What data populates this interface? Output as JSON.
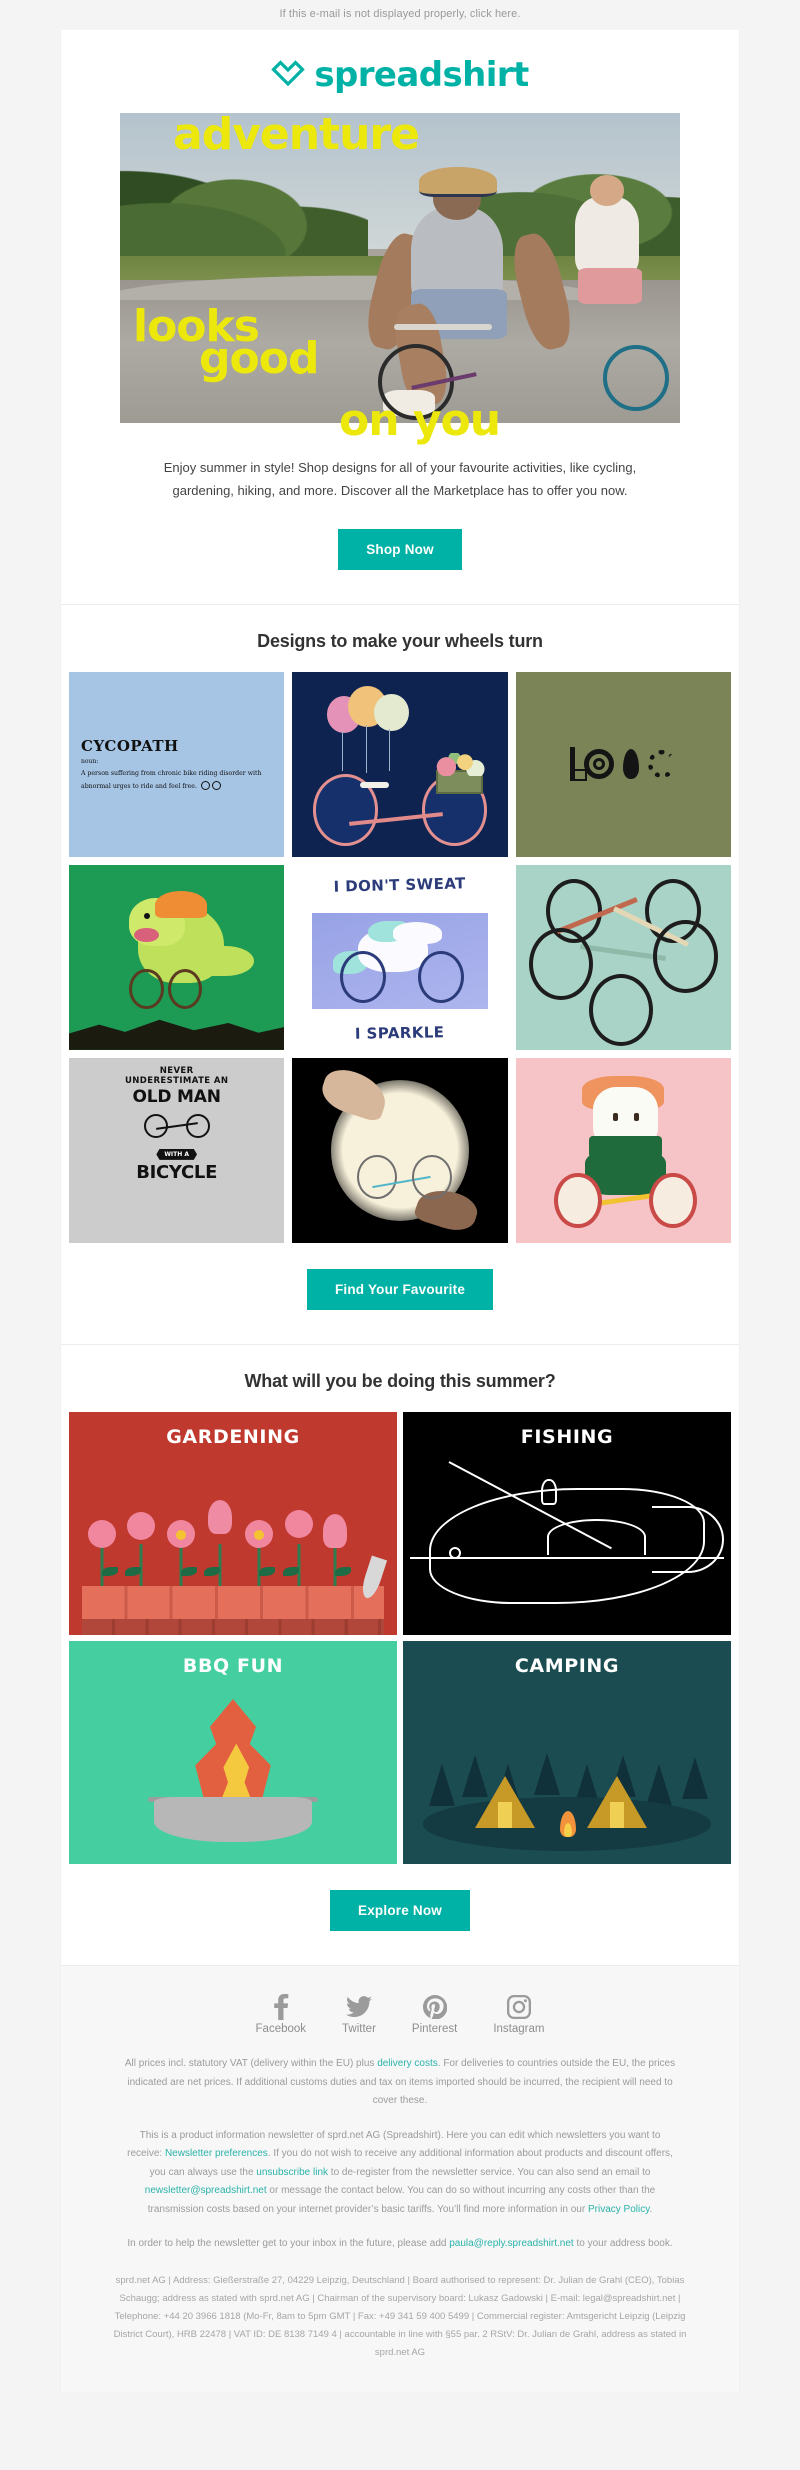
{
  "preheader": "If this e-mail is not displayed properly, click here.",
  "brand": {
    "name": "spreadshirt",
    "accent": "#00b2a5",
    "highlight": "#ece80c"
  },
  "hero": {
    "words": {
      "w1": "adventure",
      "w2": "looks",
      "w3": "good",
      "w4": "on you"
    },
    "body": "Enjoy summer in style! Shop designs for all of your favourite activities, like cycling, gardening, hiking, and more. Discover all the Marketplace has to offer you now.",
    "cta": "Shop Now"
  },
  "designs": {
    "title": "Designs to make your wheels turn",
    "cta": "Find Your Favourite",
    "tiles": [
      {
        "name": "cycopath",
        "bg": "#a6c4e4",
        "heading": "CYCOPATH",
        "pos": "noun:",
        "definition": "A person suffering from chronic bike riding disorder with abnormal urges to ride and feel free."
      },
      {
        "name": "balloon-bike",
        "bg": "#0f2350"
      },
      {
        "name": "love-bike-parts",
        "bg": "#7a8457"
      },
      {
        "name": "dino-cyclist",
        "bg": "#1d9a53"
      },
      {
        "name": "unicorn-sparkle",
        "bg": "#ffffff",
        "line1": "I DON'T SWEAT",
        "line2": "I SPARKLE"
      },
      {
        "name": "bike-collage",
        "bg": "#a9d3c6"
      },
      {
        "name": "old-man-bicycle",
        "bg": "#cccccc",
        "line1": "NEVER",
        "line2": "UNDERESTIMATE AN",
        "line3": "OLD MAN",
        "tag": "WITH A",
        "line4": "BICYCLE"
      },
      {
        "name": "creation-of-bike",
        "bg": "#000000"
      },
      {
        "name": "sushi-cyclist",
        "bg": "#f6c3c6"
      }
    ]
  },
  "summer": {
    "title": "What will you be doing this summer?",
    "cta": "Explore Now",
    "tiles": [
      {
        "label": "GARDENING",
        "bg": "#c0392f"
      },
      {
        "label": "FISHING",
        "bg": "#000000"
      },
      {
        "label": "BBQ FUN",
        "bg": "#45cfa1"
      },
      {
        "label": "CAMPING",
        "bg": "#1b4c52"
      }
    ]
  },
  "footer": {
    "social": [
      {
        "label": "Facebook",
        "icon": "facebook-icon"
      },
      {
        "label": "Twitter",
        "icon": "twitter-icon"
      },
      {
        "label": "Pinterest",
        "icon": "pinterest-icon"
      },
      {
        "label": "Instagram",
        "icon": "instagram-icon"
      }
    ],
    "vat": {
      "part1": "All prices incl. statutory VAT (delivery within the EU) plus ",
      "link1": "delivery costs",
      "part2": ". For deliveries to countries outside the EU, the prices indicated are net prices. If additional customs duties and tax on items imported should be incurred, the recipient will need to cover these."
    },
    "newsletter": {
      "part1": "This is a product information newsletter of sprd.net AG (Spreadshirt). Here you can edit which newsletters you want to receive: ",
      "link1": "Newsletter preferences",
      "part2": ". If you do not wish to receive any additional information about products and discount offers, you can always use the ",
      "link2": "unsubscribe link",
      "part3": " to de-register from the newsletter service. You can also send an email to ",
      "link3": "newsletter@spreadshirt.net",
      "part4": " or message the contact below. You can do so without incurring any costs other than the transmission costs based on your internet provider’s basic tariffs. You’ll find more information in our ",
      "link4": "Privacy Policy",
      "part5": "."
    },
    "whitelist": {
      "part1": "In order to help the newsletter get to your inbox in the future, please add ",
      "link1": "paula@reply.spreadshirt.net",
      "part2": " to your address book."
    },
    "legal": "sprd.net AG | Address: Gießerstraße 27, 04229 Leipzig, Deutschland | Board authorised to represent: Dr. Julian de Grahl (CEO), Tobias Schaugg; address as stated with sprd.net AG | Chairman of the supervisory board: Lukasz Gadowski | E-mail: legal@spreadshirt.net | Telephone: +44 20 3966 1818 (Mo-Fr, 8am to 5pm GMT | Fax: +49 341 59 400 5499 | Commercial register: Amtsgericht Leipzig (Leipzig District Court), HRB 22478 | VAT ID: DE 8138 7149 4 | accountable in line with §55 par. 2 RStV: Dr. Julian de Grahl, address as stated in sprd.net AG"
  }
}
